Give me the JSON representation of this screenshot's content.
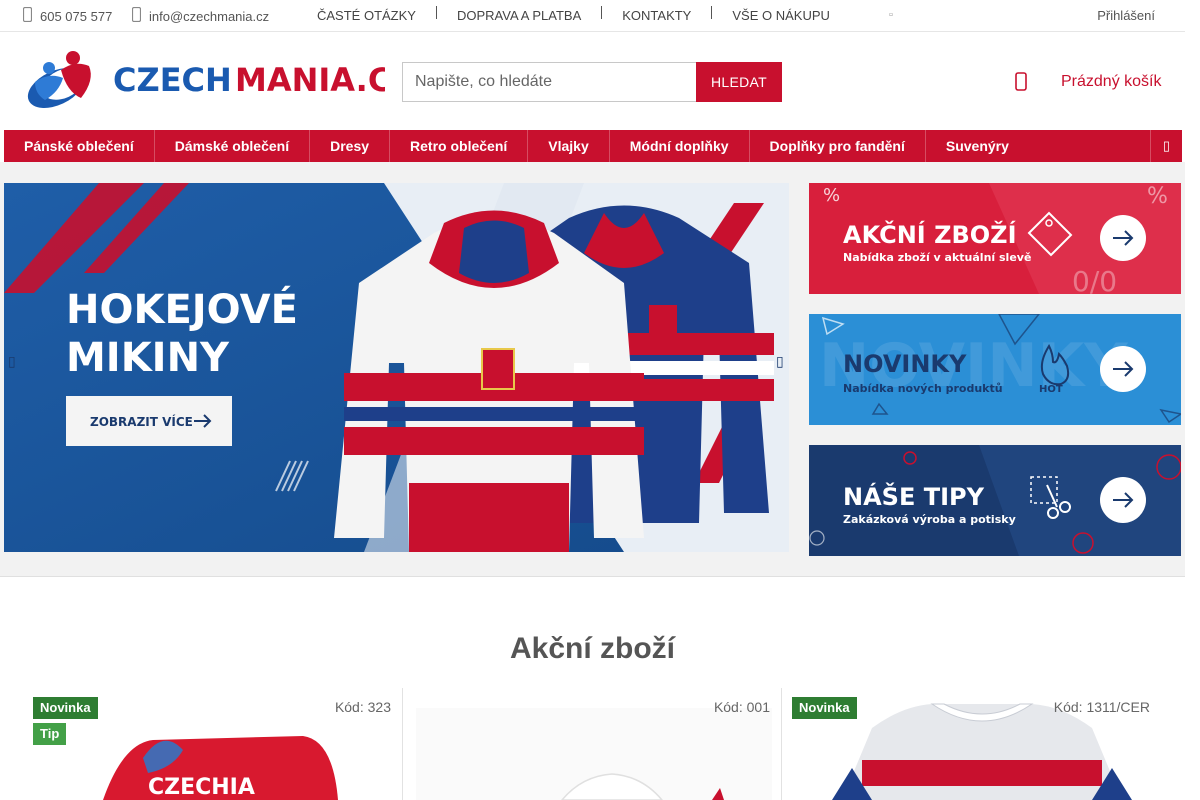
{
  "topbar": {
    "phone": "605 075 577",
    "email": "info@czechmania.cz",
    "links": [
      "ČASTÉ OTÁZKY",
      "DOPRAVA A PLATBA",
      "KONTAKTY",
      "VŠE O NÁKUPU"
    ],
    "login": "Přihlášení"
  },
  "header": {
    "logo_text_blue": "CZECH",
    "logo_text_red": "MANIA.CZ",
    "search_placeholder": "Napište, co hledáte",
    "search_button": "HLEDAT",
    "cart_label": "Prázdný košík"
  },
  "nav": {
    "items": [
      "Pánské oblečení",
      "Dámské oblečení",
      "Dresy",
      "Retro oblečení",
      "Vlajky",
      "Módní doplňky",
      "Doplňky pro fandění",
      "Suvenýry"
    ]
  },
  "slider": {
    "title_line1": "HOKEJOVÉ",
    "title_line2": "MIKINY",
    "cta": "ZOBRAZIT VÍCE"
  },
  "promos": [
    {
      "title": "AKČNÍ ZBOŽÍ",
      "subtitle": "Nabídka zboží v aktuální slevě"
    },
    {
      "title": "NOVINKY",
      "subtitle": "Nabídka nových produktů",
      "tag": "HOT"
    },
    {
      "title": "NÁŠE TIPY",
      "subtitle": "Zakázková výroba a potisky"
    }
  ],
  "section": {
    "title": "Akční zboží"
  },
  "products": [
    {
      "code": "Kód: 323",
      "badges": [
        "Novinka",
        "Tip"
      ],
      "print": "CZECHIA"
    },
    {
      "code": "Kód: 001",
      "badges": []
    },
    {
      "code": "Kód: 1311/CER",
      "badges": [
        "Novinka"
      ]
    }
  ],
  "colors": {
    "accent": "#c8102e",
    "navy": "#1a3a6e",
    "badge_green": "#2e7d32"
  }
}
